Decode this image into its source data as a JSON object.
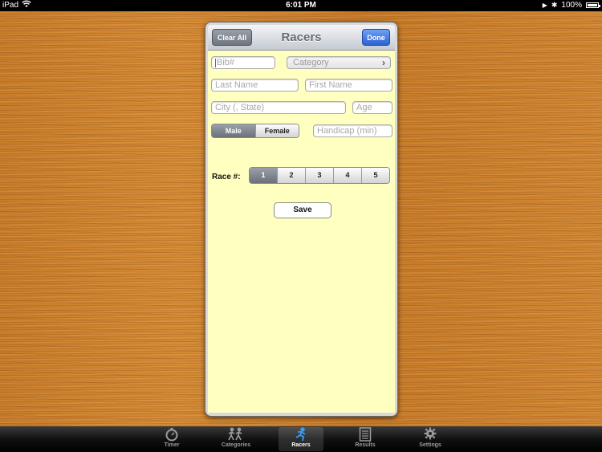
{
  "status_bar": {
    "device": "iPad",
    "time": "6:01 PM",
    "battery": "100%"
  },
  "nav": {
    "title": "Racers",
    "clear_all": "Clear All",
    "done": "Done"
  },
  "form": {
    "bib_placeholder": "Bib#",
    "category_placeholder": "Category",
    "last_name_placeholder": "Last Name",
    "first_name_placeholder": "First Name",
    "city_placeholder": "City (, State)",
    "age_placeholder": "Age",
    "gender": {
      "options": [
        "Male",
        "Female"
      ],
      "selected": "Male"
    },
    "handicap_placeholder": "Handicap (min)",
    "race_label": "Race #:",
    "race": {
      "options": [
        "1",
        "2",
        "3",
        "4",
        "5"
      ],
      "selected": "1"
    },
    "save": "Save"
  },
  "tabs": [
    {
      "label": "Timer",
      "icon": "stopwatch-icon"
    },
    {
      "label": "Categories",
      "icon": "runners-icon"
    },
    {
      "label": "Racers",
      "icon": "runner-icon",
      "active": true
    },
    {
      "label": "Results",
      "icon": "list-icon"
    },
    {
      "label": "Settings",
      "icon": "gear-icon"
    }
  ],
  "colors": {
    "form_background": "#ffffc0",
    "done_button": "#2b62d6",
    "active_tab_icon": "#3a9cf3"
  }
}
